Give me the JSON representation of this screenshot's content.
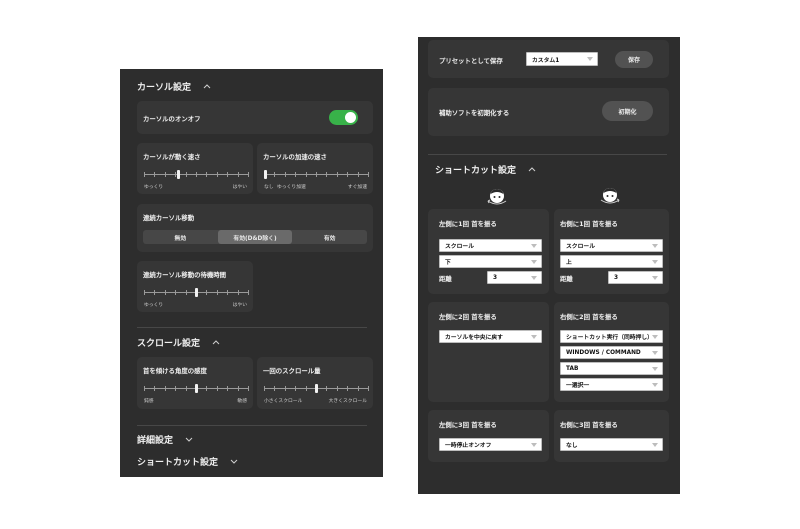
{
  "left": {
    "cursor_section": {
      "title": "カーソル設定"
    },
    "cursor_onoff": {
      "label": "カーソルのオンオフ",
      "enabled": true,
      "on_color": "#38b249"
    },
    "cursor_speed": {
      "label": "カーソルが動く速さ",
      "min_label": "ゆっくり",
      "max_label": "はやい",
      "value": 0.33
    },
    "cursor_accel": {
      "label": "カーソルの加速の速さ",
      "min_label": "なし",
      "mid_label": "ゆっくり加速",
      "max_label": "すぐ加速",
      "value": 0.0
    },
    "continuous": {
      "label": "連続カーソル移動",
      "options": [
        "無効",
        "有効(D&D除く)",
        "有効"
      ],
      "selected": 1
    },
    "continuous_wait": {
      "label": "連続カーソル移動の待機時間",
      "min_label": "ゆっくり",
      "max_label": "はやい",
      "value": 0.5
    },
    "scroll_section": {
      "title": "スクロール設定"
    },
    "tilt_sens": {
      "label": "首を傾ける角度の感度",
      "min_label": "鈍感",
      "max_label": "敏感",
      "value": 0.5
    },
    "scroll_amount": {
      "label": "一回のスクロール量",
      "min_label": "小さくスクロール",
      "max_label": "大きくスクロール",
      "value": 0.5
    },
    "advanced_section": {
      "title": "詳細設定"
    },
    "shortcut_section": {
      "title": "ショートカット設定"
    }
  },
  "right": {
    "preset": {
      "label": "プリセットとして保存",
      "value": "カスタム1",
      "save_label": "保存"
    },
    "reset": {
      "label": "補助ソフトを初期化する",
      "button_label": "初期化"
    },
    "shortcut_section": {
      "title": "ショートカット設定"
    },
    "left1": {
      "title": "左側に1回 首を振る",
      "action": "スクロール",
      "direction": "下",
      "distance_label": "距離",
      "distance": "3"
    },
    "right1": {
      "title": "右側に1回 首を振る",
      "action": "スクロール",
      "direction": "上",
      "distance_label": "距離",
      "distance": "3"
    },
    "left2": {
      "title": "左側に2回 首を振る",
      "action": "カーソルを中央に戻す"
    },
    "right2": {
      "title": "右側に2回 首を振る",
      "action": "ショートカット実行（同時押し）",
      "key1": "WINDOWS / COMMAND",
      "key2": "TAB",
      "key3": "一選択一"
    },
    "left3": {
      "title": "左側に3回 首を振る",
      "action": "一時停止オンオフ"
    },
    "right3": {
      "title": "右側に3回 首を振る",
      "action": "なし"
    }
  },
  "icons": {
    "chevron_up": "chevron-up-icon",
    "chevron_down": "chevron-down-icon",
    "face_left": "head-turn-left-icon",
    "face_right": "head-turn-right-icon"
  }
}
